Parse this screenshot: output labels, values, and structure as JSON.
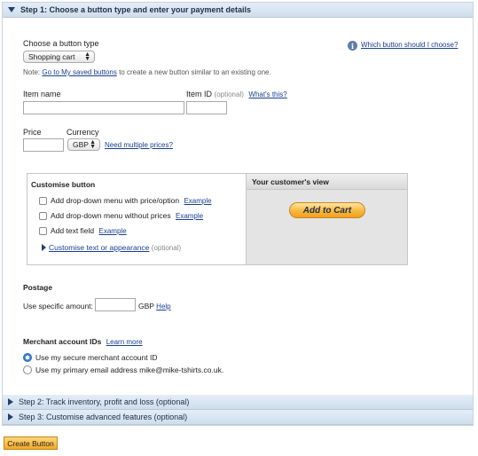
{
  "step1": {
    "title": "Step 1: Choose a button type and enter your payment details"
  },
  "button_type": {
    "label": "Choose a button type",
    "selected": "Shopping cart",
    "help_link": "Which button should I choose?"
  },
  "note": {
    "prefix": "Note: ",
    "link": "Go to My saved buttons",
    "suffix": " to create a new button similar to an existing one."
  },
  "item_name": {
    "label": "Item name",
    "value": ""
  },
  "item_id": {
    "label": "Item ID",
    "optional": "(optional)",
    "whats_this": "What's this?",
    "value": ""
  },
  "price": {
    "label": "Price",
    "value": ""
  },
  "currency": {
    "label": "Currency",
    "selected": "GBP",
    "multi_link": "Need multiple prices?"
  },
  "customise": {
    "title": "Customise button",
    "options": [
      {
        "label": "Add drop-down menu with price/option",
        "example": "Example",
        "checked": false
      },
      {
        "label": "Add drop-down menu without prices",
        "example": "Example",
        "checked": false
      },
      {
        "label": "Add text field",
        "example": "Example",
        "checked": false
      }
    ],
    "appearance_link": "Customise text or appearance",
    "appearance_optional": "(optional)"
  },
  "preview": {
    "title": "Your customer's view",
    "button_label": "Add to Cart"
  },
  "postage": {
    "title": "Postage",
    "label": "Use specific amount:",
    "value": "",
    "currency": "GBP",
    "help": "Help"
  },
  "merchant": {
    "title": "Merchant account IDs",
    "learn_more": "Learn more",
    "options": [
      {
        "label": "Use my secure merchant account ID",
        "selected": true
      },
      {
        "label": "Use my primary email address mike@mike-tshirts.co.uk.",
        "selected": false
      }
    ]
  },
  "step2": {
    "title": "Step 2: Track inventory, profit and loss (optional)"
  },
  "step3": {
    "title": "Step 3: Customise advanced features (optional)"
  },
  "create_button": {
    "label": "Create Button"
  }
}
